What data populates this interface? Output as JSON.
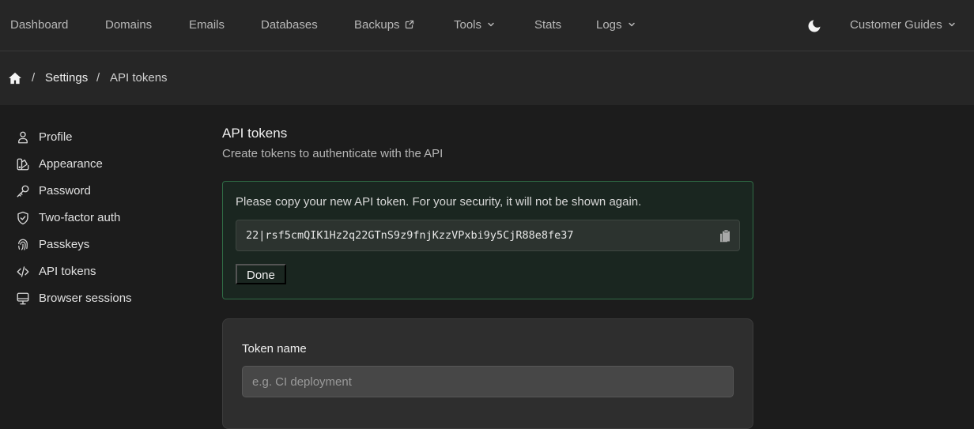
{
  "nav": {
    "items": [
      {
        "label": "Dashboard"
      },
      {
        "label": "Domains"
      },
      {
        "label": "Emails"
      },
      {
        "label": "Databases"
      },
      {
        "label": "Backups"
      },
      {
        "label": "Tools"
      },
      {
        "label": "Stats"
      },
      {
        "label": "Logs"
      }
    ],
    "guides": "Customer Guides"
  },
  "breadcrumb": {
    "items": [
      {
        "label": "Settings"
      },
      {
        "label": "API tokens"
      }
    ],
    "separator": "/"
  },
  "sidebar": {
    "items": [
      {
        "label": "Profile",
        "icon": "user-icon"
      },
      {
        "label": "Appearance",
        "icon": "palette-icon"
      },
      {
        "label": "Password",
        "icon": "key-icon"
      },
      {
        "label": "Two-factor auth",
        "icon": "shield-check-icon"
      },
      {
        "label": "Passkeys",
        "icon": "fingerprint-icon"
      },
      {
        "label": "API tokens",
        "icon": "code-icon"
      },
      {
        "label": "Browser sessions",
        "icon": "monitor-icon"
      }
    ]
  },
  "main": {
    "title": "API tokens",
    "subtitle": "Create tokens to authenticate with the API",
    "notice": {
      "message": "Please copy your new API token. For your security, it will not be shown again.",
      "token": "22|rsf5cmQIK1Hz2q22GTnS9z9fnjKzzVPxbi9y5CjR88e8fe37",
      "done": "Done"
    },
    "form": {
      "label": "Token name",
      "placeholder": "e.g. CI deployment",
      "value": ""
    }
  },
  "colors": {
    "background": "#1c1c1c",
    "header": "#262626",
    "success_border": "#2f6b45"
  }
}
